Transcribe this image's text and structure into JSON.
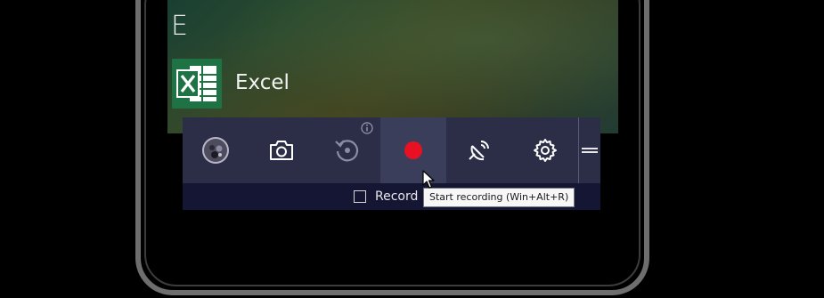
{
  "start_menu": {
    "section_letter": "E",
    "app": {
      "name": "Excel",
      "icon": "excel-icon"
    }
  },
  "gamebar": {
    "buttons": [
      {
        "icon": "xbox-avatar-icon"
      },
      {
        "icon": "camera-icon"
      },
      {
        "icon": "record-that-icon"
      },
      {
        "icon": "record-icon",
        "active": true
      },
      {
        "icon": "broadcast-icon"
      },
      {
        "icon": "settings-gear-icon"
      }
    ],
    "info_icon": "info-icon",
    "grip_icon": "grip-icon",
    "record_mic_label": "Record m",
    "record_mic_checked": false,
    "tooltip": "Start recording (Win+Alt+R)"
  },
  "colors": {
    "record_dot": "#e81123",
    "gamebar_bg": "#2c2e48",
    "excel_green": "#1f7244"
  }
}
